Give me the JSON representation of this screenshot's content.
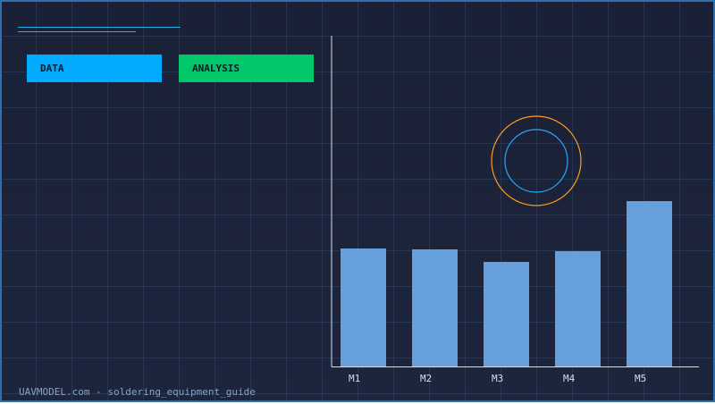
{
  "colors": {
    "tag_data": "#00aaff",
    "tag_analysis": "#00c86a",
    "bar": "#66a0dc",
    "axis": "#d8dee8",
    "ring_outer": "#ff9a1f",
    "ring_inner": "#26a8ff"
  },
  "tags": {
    "data_label": "DATA",
    "analysis_label": "ANALYSIS"
  },
  "footer": {
    "text": "UAVMODEL.com - soldering_equipment_guide"
  },
  "chart_data": {
    "type": "bar",
    "categories": [
      "M1",
      "M2",
      "M3",
      "M4",
      "M5"
    ],
    "values": [
      132,
      131,
      117,
      129,
      185
    ],
    "title": "",
    "xlabel": "",
    "ylabel": "",
    "ylim": [
      0,
      370
    ],
    "grid": true
  }
}
